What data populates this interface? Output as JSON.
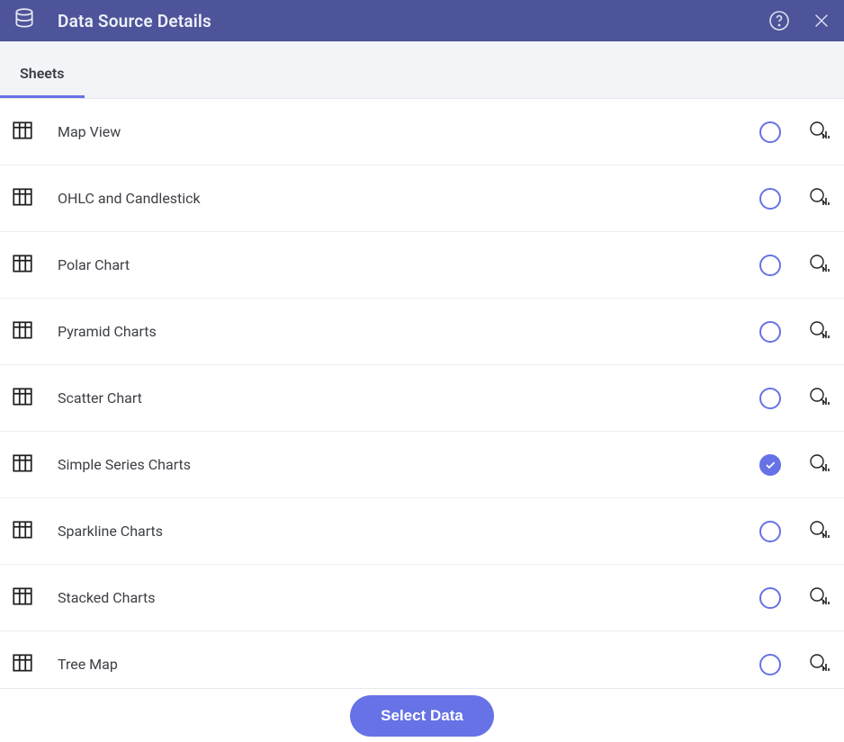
{
  "header": {
    "title": "Data Source Details"
  },
  "tabs": [
    {
      "label": "Sheets",
      "active": true
    }
  ],
  "sheets": [
    {
      "label": "Map View",
      "selected": false
    },
    {
      "label": "OHLC and Candlestick",
      "selected": false
    },
    {
      "label": "Polar Chart",
      "selected": false
    },
    {
      "label": "Pyramid Charts",
      "selected": false
    },
    {
      "label": "Scatter Chart",
      "selected": false
    },
    {
      "label": "Simple Series Charts",
      "selected": true
    },
    {
      "label": "Sparkline Charts",
      "selected": false
    },
    {
      "label": "Stacked Charts",
      "selected": false
    },
    {
      "label": "Tree Map",
      "selected": false
    }
  ],
  "footer": {
    "select_label": "Select Data"
  }
}
